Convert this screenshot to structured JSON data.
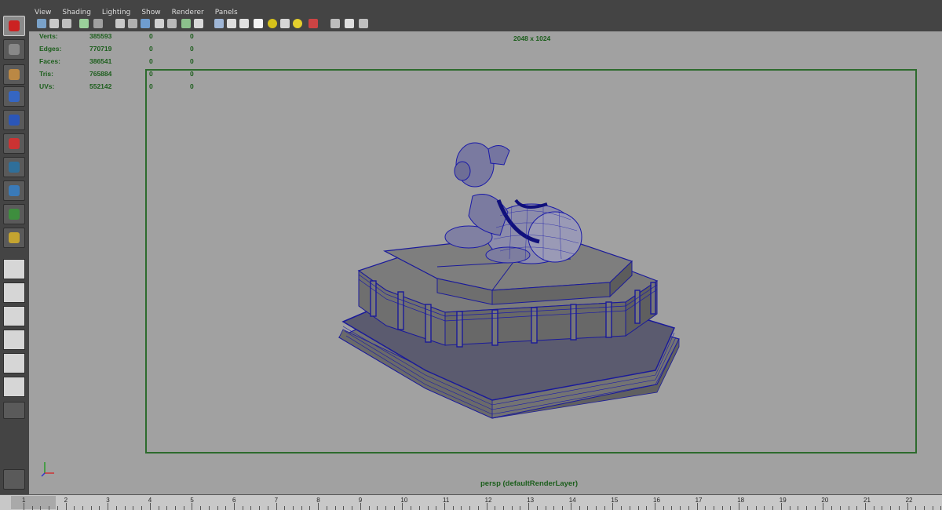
{
  "menu": [
    "View",
    "Shading",
    "Lighting",
    "Show",
    "Renderer",
    "Panels"
  ],
  "stats": {
    "rows": [
      {
        "label": "Verts:",
        "v1": "385593",
        "v2": "0",
        "v3": "0"
      },
      {
        "label": "Edges:",
        "v1": "770719",
        "v2": "0",
        "v3": "0"
      },
      {
        "label": "Faces:",
        "v1": "386541",
        "v2": "0",
        "v3": "0"
      },
      {
        "label": "Tris:",
        "v1": "765884",
        "v2": "0",
        "v3": "0"
      },
      {
        "label": "UVs:",
        "v1": "552142",
        "v2": "0",
        "v3": "0"
      }
    ]
  },
  "viewport": {
    "resolution": "2048 x 1024",
    "camera": "persp (defaultRenderLayer)"
  },
  "left_toolbar": {
    "tools": [
      "select-tool-icon",
      "lasso-tool-icon",
      "paint-select-tool-icon",
      "move-tool-icon",
      "rotate-tool-icon",
      "scale-tool-icon",
      "universal-manipulator-icon",
      "soft-modification-icon",
      "show-manipulator-icon",
      "last-tool-icon"
    ],
    "layouts": [
      "single-perspective-layout-icon",
      "four-view-layout-icon",
      "outliner-perspective-layout-icon",
      "graph-editor-layout-icon",
      "hypershade-layout-icon",
      "custom-layout-icon"
    ]
  },
  "panel_icons": [
    "select-camera-icon",
    "camera-attributes-icon",
    "bookmarks-icon",
    "image-plane-icon",
    "2d-pan-zoom-icon",
    "grid-icon",
    "film-gate-icon",
    "resolution-gate-icon",
    "gate-mask-icon",
    "field-chart-icon",
    "safe-action-icon",
    "safe-title-icon",
    "wireframe-icon",
    "smooth-shade-icon",
    "wireframe-on-shaded-icon",
    "textured-icon",
    "use-all-lights-icon",
    "shadows-icon",
    "screen-space-ao-icon",
    "isolate-select-icon",
    "xray-icon",
    "xray-joints-icon",
    "xray-components-icon"
  ],
  "timeline": {
    "ticks": [
      "1",
      "2",
      "3",
      "4",
      "5",
      "6",
      "7",
      "8",
      "9",
      "10",
      "11",
      "12",
      "13",
      "14",
      "15",
      "16",
      "17",
      "18",
      "19",
      "20",
      "21",
      "22"
    ]
  },
  "colors": {
    "hud_text": "#1c5e1c",
    "resolution_gate": "#2d6b2d",
    "wireframe": "#1a1a9a",
    "viewport_bg": "#a1a1a1"
  }
}
